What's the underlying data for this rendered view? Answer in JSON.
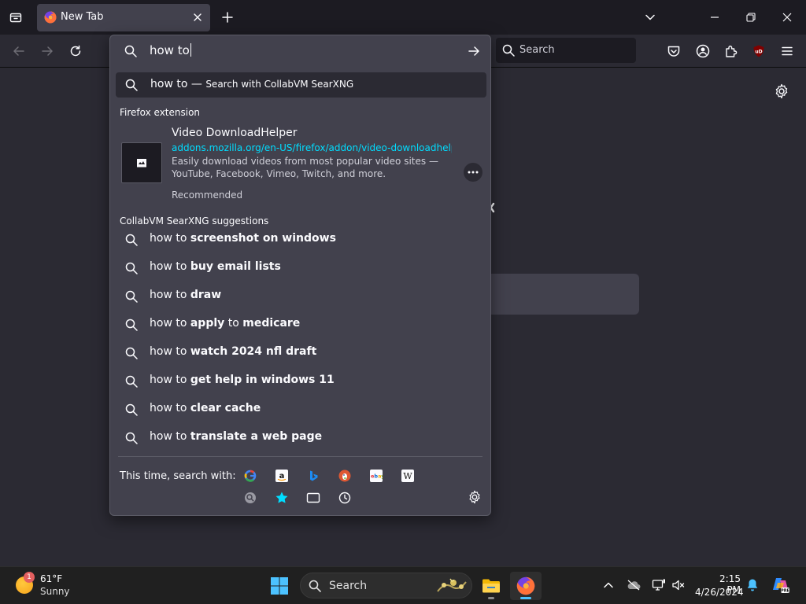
{
  "tab": {
    "title": "New Tab"
  },
  "navbar": {
    "search_placeholder": "Search"
  },
  "urlbar": {
    "input": "how to",
    "heuristic": {
      "query": "how to",
      "separator": "—",
      "action": "Search with CollabVM SearXNG"
    }
  },
  "extension_group": {
    "label": "Firefox extension",
    "title": "Video DownloadHelper",
    "url": "addons.mozilla.org/en-US/firefox/addon/video-downloadhelper/?u",
    "description": "Easily download videos from most popular video sites — YouTube, Facebook, Vimeo, Twitch, and more.",
    "recommended": "Recommended"
  },
  "suggestions": {
    "label": "CollabVM SearXNG suggestions",
    "items": [
      {
        "prefix": "how to",
        "bold": "screenshot on windows"
      },
      {
        "prefix": "how to",
        "bold": "buy email lists"
      },
      {
        "prefix": "how to",
        "bold": "draw"
      },
      {
        "prefix": "how to",
        "bold": "apply",
        "mid": "to",
        "bold2": "medicare"
      },
      {
        "prefix": "how to",
        "bold": "watch 2024 nfl draft"
      },
      {
        "prefix": "how to",
        "bold": "get help in windows 11"
      },
      {
        "prefix": "how to",
        "bold": "clear cache"
      },
      {
        "prefix": "how to",
        "bold": "translate a web page"
      }
    ]
  },
  "oneoff": {
    "label": "This time, search with:",
    "engines": [
      "google-icon",
      "amazon-icon",
      "bing-icon",
      "duckduckgo-icon",
      "ebay-icon",
      "wikipedia-icon"
    ],
    "modes": [
      "searxng-icon",
      "bookmarks-icon",
      "tabs-icon",
      "history-icon"
    ]
  },
  "taskbar": {
    "weather_badge": "1",
    "temperature": "61°F",
    "condition": "Sunny",
    "search_label": "Search",
    "time": "2:15 PM",
    "date": "4/26/2024"
  },
  "colors": {
    "toolbar": "#2b2a33",
    "tabstrip": "#1c1b22",
    "panel": "#42414d",
    "link": "#00ddff",
    "accent": "#4cc2ff"
  }
}
